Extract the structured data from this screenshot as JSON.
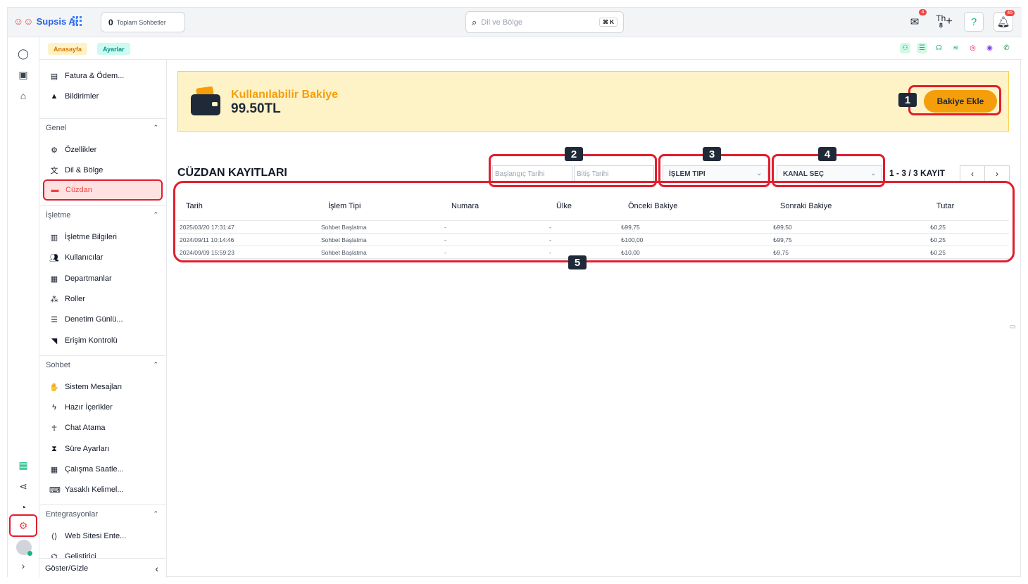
{
  "app": {
    "name": "Supsis Ai"
  },
  "topbar": {
    "chat_count_value": "0",
    "chat_count_label": "Toplam Sohbetler",
    "search_placeholder": "Dil ve Bölge",
    "search_shortcut": "⌘ K",
    "mail_badge": "4",
    "th_label": "Th",
    "th_count": "8",
    "notif_badge": "45"
  },
  "breadcrumb": {
    "home": "Anasayfa",
    "settings": "Ayarlar"
  },
  "sidebar": {
    "top_items": [
      {
        "label": "Fatura & Ödem...",
        "icon": "invoice-icon"
      },
      {
        "label": "Bildirimler",
        "icon": "bell-icon"
      }
    ],
    "sections": [
      {
        "title": "Genel",
        "items": [
          {
            "label": "Özellikler",
            "icon": "gear-icon"
          },
          {
            "label": "Dil & Bölge",
            "icon": "translate-icon"
          },
          {
            "label": "Cüzdan",
            "icon": "wallet-icon",
            "active": true
          }
        ]
      },
      {
        "title": "İşletme",
        "items": [
          {
            "label": "İşletme Bilgileri",
            "icon": "building-icon"
          },
          {
            "label": "Kullanıcılar",
            "icon": "users-icon"
          },
          {
            "label": "Departmanlar",
            "icon": "department-icon"
          },
          {
            "label": "Roller",
            "icon": "roles-icon"
          },
          {
            "label": "Denetim Günlü...",
            "icon": "list-icon"
          },
          {
            "label": "Erişim Kontrolü",
            "icon": "wifi-icon"
          }
        ]
      },
      {
        "title": "Sohbet",
        "items": [
          {
            "label": "Sistem Mesajları",
            "icon": "wave-icon"
          },
          {
            "label": "Hazır İçerikler",
            "icon": "bolt-icon"
          },
          {
            "label": "Chat Atama",
            "icon": "person-icon"
          },
          {
            "label": "Süre Ayarları",
            "icon": "hourglass-icon"
          },
          {
            "label": "Çalışma Saatle...",
            "icon": "calendar-icon"
          },
          {
            "label": "Yasaklı Kelimel...",
            "icon": "keyboard-icon"
          }
        ]
      },
      {
        "title": "Entegrasyonlar",
        "items": [
          {
            "label": "Web Sitesi Ente...",
            "icon": "code-icon"
          },
          {
            "label": "Geliştirici",
            "icon": "developer-icon"
          }
        ]
      }
    ],
    "toggle_label": "Göster/Gizle"
  },
  "balance": {
    "label": "Kullanılabilir Bakiye",
    "value": "99.50TL",
    "add_button": "Bakiye Ekle"
  },
  "wallet_records": {
    "title": "CÜZDAN KAYITLARI",
    "start_date_placeholder": "Başlangıç Tarihi",
    "end_date_placeholder": "Bitiş Tarihi",
    "type_select": "İŞLEM TIPI",
    "channel_select": "KANAL SEÇ",
    "range": "1 - 3 / 3 KAYIT",
    "columns": [
      "Tarih",
      "İşlem Tipi",
      "Numara",
      "Ülke",
      "Önceki Bakiye",
      "Sonraki Bakiye",
      "Tutar"
    ],
    "rows": [
      [
        "2025/03/20 17:31:47",
        "Sohbet Başlatma",
        "-",
        "-",
        "₺99,75",
        "₺99,50",
        "₺0,25"
      ],
      [
        "2024/09/11 10:14:46",
        "Sohbet Başlatma",
        "-",
        "-",
        "₺100,00",
        "₺99,75",
        "₺0,25"
      ],
      [
        "2024/09/09 15:59:23",
        "Sohbet Başlatma",
        "-",
        "-",
        "₺10,00",
        "₺9,75",
        "₺0,25"
      ]
    ]
  },
  "callouts": [
    "1",
    "2",
    "3",
    "4",
    "5"
  ],
  "colors": {
    "accent": "#f59e0b",
    "highlight": "#e11d2e",
    "brand": "#2563eb"
  }
}
